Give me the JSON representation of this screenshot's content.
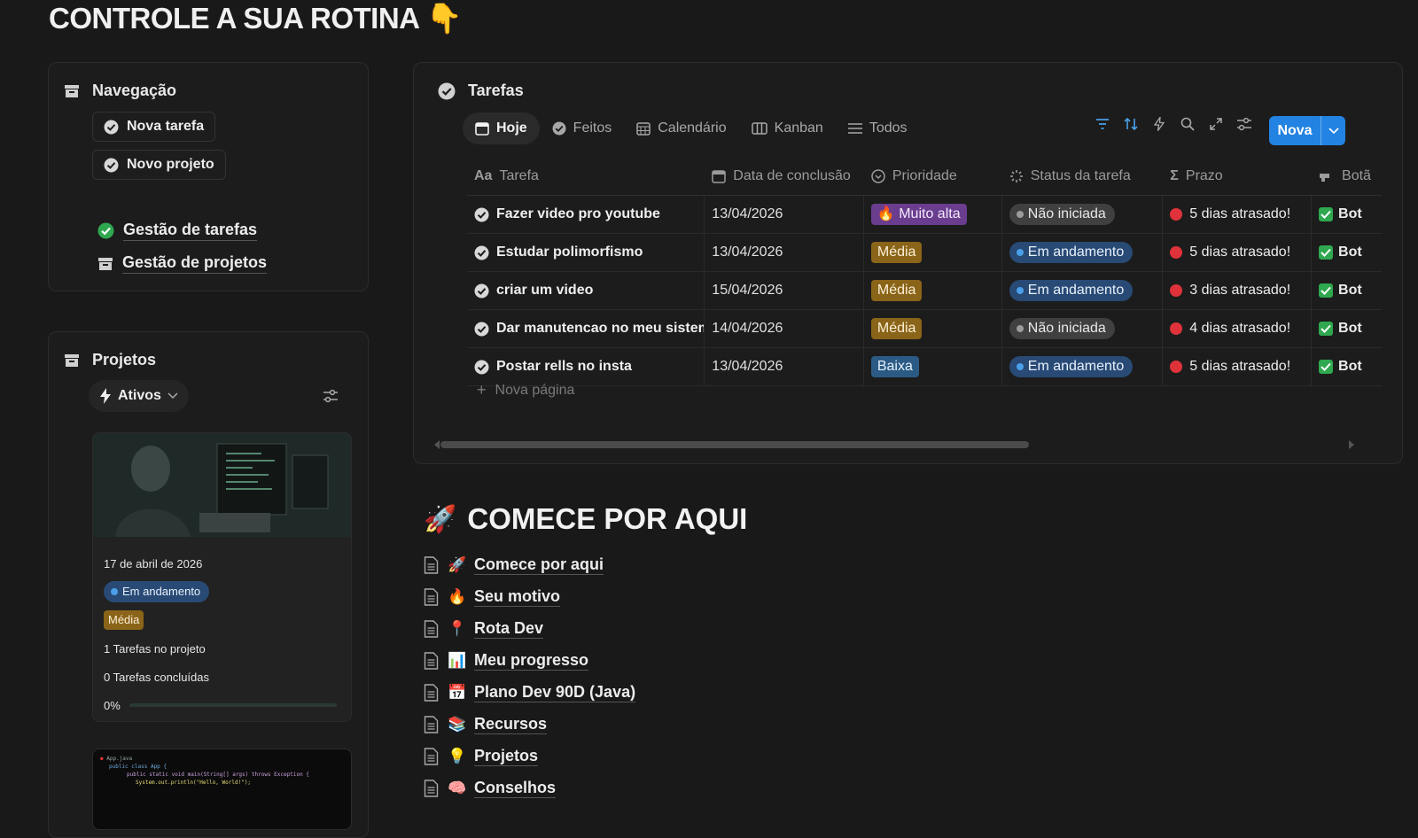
{
  "page": {
    "title": "CONTROLE A SUA ROTINA 👇"
  },
  "navigation": {
    "title": "Navegação",
    "buttons": {
      "new_task": "Nova tarefa",
      "new_project": "Novo projeto"
    },
    "links": {
      "tasks": "Gestão de tarefas",
      "projects": "Gestão de projetos"
    }
  },
  "projects": {
    "title": "Projetos",
    "filter": "Ativos",
    "card": {
      "date": "17 de abril de 2026",
      "status": "Em andamento",
      "priority": "Média",
      "tasks_in_project": "1 Tarefas no projeto",
      "tasks_done": "0 Tarefas concluídas",
      "progress_label": "0%",
      "progress": 0
    },
    "card2": {
      "tab_label": "App.java",
      "code_line1": "public class App {",
      "code_line2": "public static void main(String[] args) throws Exception {",
      "code_line3": "System.out.println(\"Hello, World!\");"
    }
  },
  "tasks": {
    "title": "Tarefas",
    "tabs": [
      "Hoje",
      "Feitos",
      "Calendário",
      "Kanban",
      "Todos"
    ],
    "new_button": "Nova",
    "columns": [
      "Tarefa",
      "Data de conclusão",
      "Prioridade",
      "Status da tarefa",
      "Prazo",
      "Botã"
    ],
    "rows": [
      {
        "name": "Fazer video pro youtube",
        "date": "13/04/2026",
        "priority": "🔥 Muito alta",
        "status": "Não iniciada",
        "deadline": "5 dias atrasado!",
        "button": "Bot"
      },
      {
        "name": "Estudar polimorfismo",
        "date": "13/04/2026",
        "priority": "Média",
        "status": "Em andamento",
        "deadline": "5 dias atrasado!",
        "button": "Bot"
      },
      {
        "name": "criar um video",
        "date": "15/04/2026",
        "priority": "Média",
        "status": "Em andamento",
        "deadline": "3 dias atrasado!",
        "button": "Bot"
      },
      {
        "name": "Dar manutencao no meu sistema",
        "date": "14/04/2026",
        "priority": "Média",
        "status": "Não iniciada",
        "deadline": "4 dias atrasado!",
        "button": "Bot"
      },
      {
        "name": "Postar rells no insta",
        "date": "13/04/2026",
        "priority": "Baixa",
        "status": "Em andamento",
        "deadline": "5 dias atrasado!",
        "button": "Bot"
      }
    ],
    "new_page": "Nova página"
  },
  "start": {
    "title": "COMECE POR AQUI",
    "links": [
      {
        "emoji": "🚀",
        "label": "Comece por aqui"
      },
      {
        "emoji": "🔥",
        "label": "Seu motivo"
      },
      {
        "emoji": "📍",
        "label": "Rota Dev"
      },
      {
        "emoji": "📊",
        "label": "Meu progresso"
      },
      {
        "emoji": "📅",
        "label": "Plano Dev 90D (Java)"
      },
      {
        "emoji": "📚",
        "label": "Recursos"
      },
      {
        "emoji": "💡",
        "label": "Projetos"
      },
      {
        "emoji": "🧠",
        "label": "Conselhos"
      }
    ]
  },
  "colors": {
    "accent": "#2383e2",
    "success": "#2fa84f",
    "danger": "#e0323a",
    "background": "#191919"
  }
}
